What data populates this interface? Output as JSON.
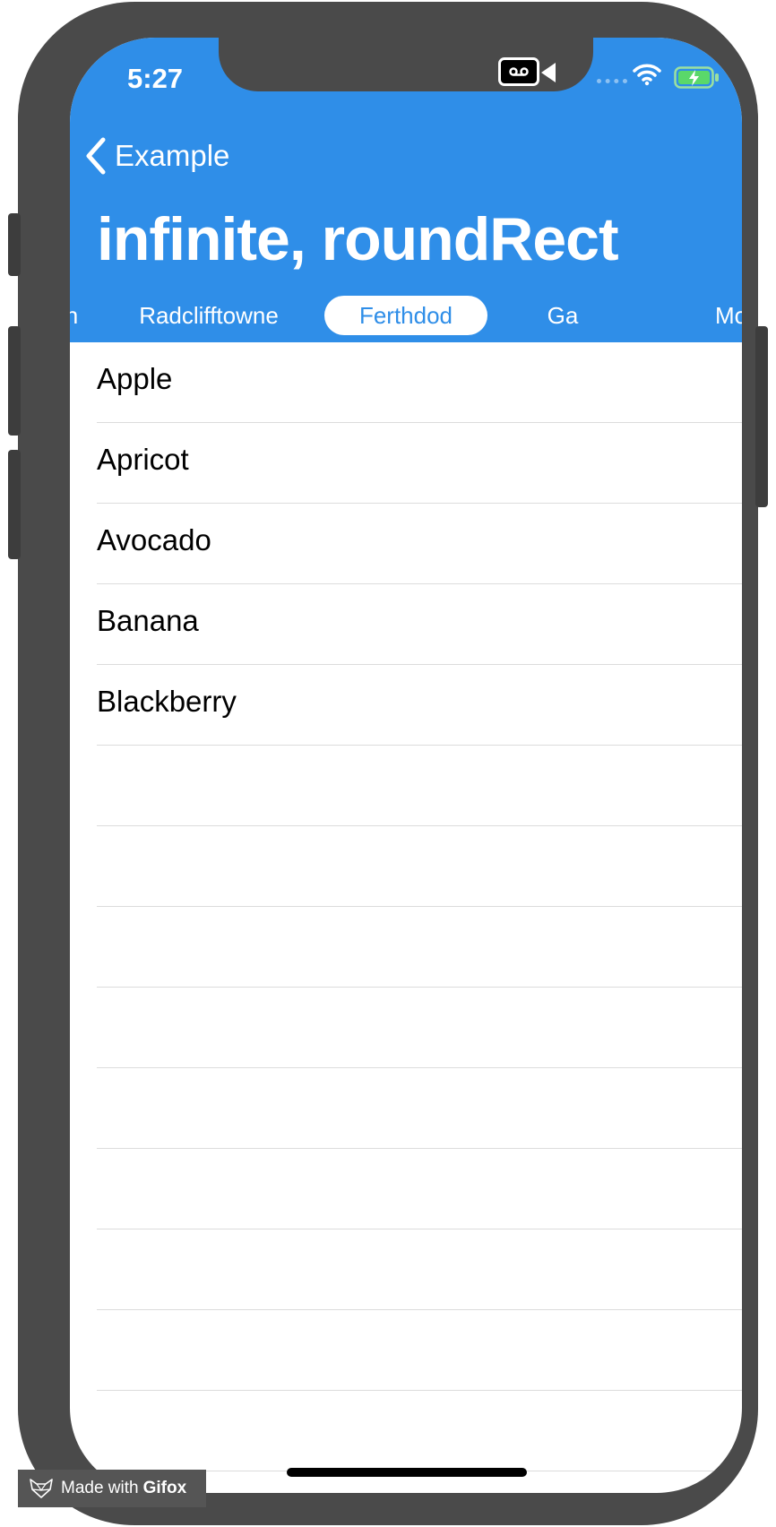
{
  "status_bar": {
    "time": "5:27"
  },
  "nav": {
    "back_label": "Example",
    "title": "infinite, roundRect"
  },
  "tabs": [
    {
      "label": "n",
      "selected": false
    },
    {
      "label": "Radclifftowne",
      "selected": false
    },
    {
      "label": "Ferthdod",
      "selected": true
    },
    {
      "label": "Ga",
      "selected": false
    },
    {
      "label": "Mo",
      "selected": false
    }
  ],
  "list": {
    "items": [
      "Apple",
      "Apricot",
      "Avocado",
      "Banana",
      "Blackberry",
      "",
      "",
      "",
      "",
      "",
      "",
      "",
      "",
      ""
    ]
  },
  "watermark": {
    "prefix": "Made with",
    "brand": "Gifox"
  },
  "colors": {
    "accent": "#2f8ee8",
    "device": "#4a4a4a"
  },
  "icons": [
    "chevron-left-icon",
    "screen-record-icon",
    "wifi-icon",
    "battery-charging-icon",
    "gifox-fox-icon"
  ]
}
